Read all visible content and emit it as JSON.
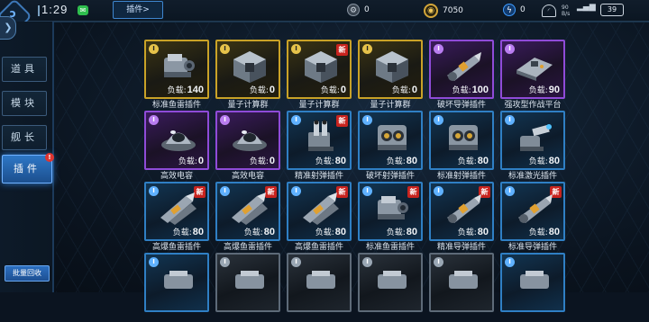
{
  "topbar": {
    "logo_glyph": "ↄ",
    "clock": "1:29",
    "tab_label": "插件>",
    "resources": [
      {
        "icon": "gear-coin-icon",
        "value": "0"
      },
      {
        "icon": "gold-coin-icon",
        "value": "7050"
      },
      {
        "icon": "energy-icon",
        "value": "0"
      }
    ],
    "net_speed": "90 B/s",
    "battery": "39"
  },
  "sidebar": {
    "items": [
      {
        "label": "道具",
        "active": false
      },
      {
        "label": "模块",
        "active": false
      },
      {
        "label": "舰长",
        "active": false
      },
      {
        "label": "插件",
        "active": true
      }
    ],
    "alert_glyph": "!",
    "recycle_label": "批量回收"
  },
  "load_label": "负载:",
  "cards": [
    {
      "name": "标准鱼雷插件",
      "load": "140",
      "rarity": "gold",
      "new": false,
      "icon": "torpedo-launcher-icon"
    },
    {
      "name": "量子计算群",
      "load": "0",
      "rarity": "gold",
      "new": false,
      "icon": "quantum-cube-icon"
    },
    {
      "name": "量子计算群",
      "load": "0",
      "rarity": "gold",
      "new": true,
      "icon": "quantum-cube-icon"
    },
    {
      "name": "量子计算群",
      "load": "0",
      "rarity": "gold",
      "new": false,
      "icon": "quantum-cube-icon"
    },
    {
      "name": "破坏导弹插件",
      "load": "100",
      "rarity": "purple",
      "new": false,
      "icon": "missile-pod-icon"
    },
    {
      "name": "强攻型作战平台",
      "load": "90",
      "rarity": "purple",
      "new": false,
      "icon": "combat-platform-icon"
    },
    {
      "name": "高效电容",
      "load": "0",
      "rarity": "purple",
      "new": false,
      "icon": "capacitor-dome-icon"
    },
    {
      "name": "高效电容",
      "load": "0",
      "rarity": "purple",
      "new": false,
      "icon": "capacitor-dome-icon"
    },
    {
      "name": "精准射弹插件",
      "load": "80",
      "rarity": "blue",
      "new": true,
      "icon": "twin-cannon-icon"
    },
    {
      "name": "破坏射弹插件",
      "load": "80",
      "rarity": "blue",
      "new": false,
      "icon": "shell-launcher-icon"
    },
    {
      "name": "标准射弹插件",
      "load": "80",
      "rarity": "blue",
      "new": false,
      "icon": "shell-launcher-icon"
    },
    {
      "name": "标准激光插件",
      "load": "80",
      "rarity": "blue",
      "new": false,
      "icon": "laser-turret-icon"
    },
    {
      "name": "高爆鱼雷插件",
      "load": "80",
      "rarity": "blue",
      "new": true,
      "icon": "torpedo-rack-icon"
    },
    {
      "name": "高爆鱼雷插件",
      "load": "80",
      "rarity": "blue",
      "new": true,
      "icon": "torpedo-rack-icon"
    },
    {
      "name": "高爆鱼雷插件",
      "load": "80",
      "rarity": "blue",
      "new": true,
      "icon": "torpedo-rack-icon"
    },
    {
      "name": "标准鱼雷插件",
      "load": "80",
      "rarity": "blue",
      "new": true,
      "icon": "torpedo-launcher-icon"
    },
    {
      "name": "精准导弹插件",
      "load": "80",
      "rarity": "blue",
      "new": true,
      "icon": "missile-pod-icon"
    },
    {
      "name": "标准导弹插件",
      "load": "80",
      "rarity": "blue",
      "new": true,
      "icon": "missile-pod-icon"
    },
    {
      "name": "",
      "load": "",
      "rarity": "blue",
      "new": false,
      "icon": "module-icon"
    },
    {
      "name": "",
      "load": "",
      "rarity": "grey",
      "new": false,
      "icon": "module-icon"
    },
    {
      "name": "",
      "load": "",
      "rarity": "grey",
      "new": false,
      "icon": "module-icon"
    },
    {
      "name": "",
      "load": "",
      "rarity": "grey",
      "new": false,
      "icon": "module-icon"
    },
    {
      "name": "",
      "load": "",
      "rarity": "grey",
      "new": false,
      "icon": "module-icon"
    },
    {
      "name": "",
      "load": "",
      "rarity": "blue",
      "new": false,
      "icon": "module-icon"
    }
  ],
  "badge_glyph": "I",
  "new_glyph": "新"
}
